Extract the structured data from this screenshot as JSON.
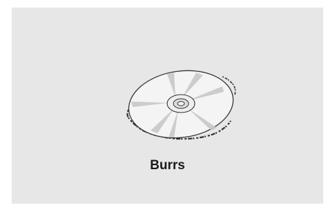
{
  "caption": "Burrs",
  "figure": {
    "icon": "disc-with-burrs-icon",
    "colors": {
      "background": "#e7e7e7",
      "disc_fill": "#f4f4f4",
      "outline": "#333333",
      "reflection": "#c8c8c8"
    }
  }
}
